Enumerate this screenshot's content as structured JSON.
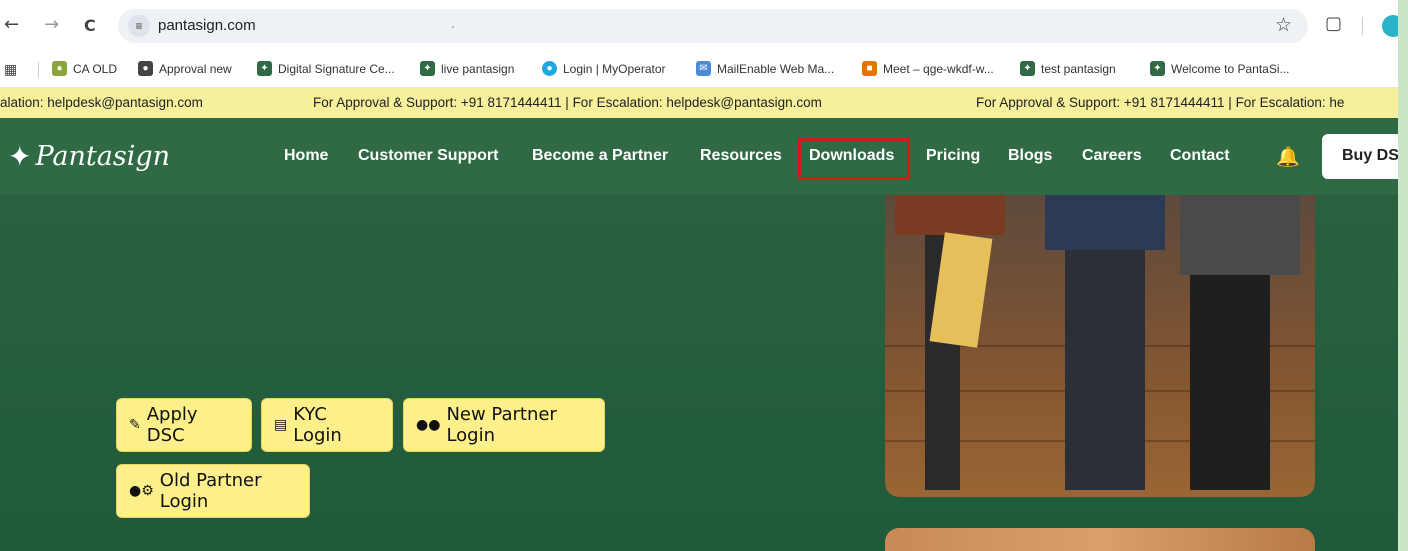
{
  "browser": {
    "url": "pantasign.com",
    "url_dot": ".",
    "nav": {
      "back": "←",
      "forward": "→",
      "reload": "C"
    },
    "site_info_icon": "tune-icon",
    "bookmark_star": "☆"
  },
  "bookmarks": [
    {
      "label": "CA OLD",
      "icon": "ca-icon",
      "color": "#8aa53a"
    },
    {
      "label": "Approval new",
      "icon": "globe-icon",
      "color": "#444444"
    },
    {
      "label": "Digital Signature Ce...",
      "icon": "pantasign-icon",
      "color": "#2f6a45"
    },
    {
      "label": "live pantasign",
      "icon": "pantasign-icon",
      "color": "#2f6a45"
    },
    {
      "label": "Login | MyOperator",
      "icon": "myoperator-icon",
      "color": "#1fa8e0"
    },
    {
      "label": "MailEnable Web Ma...",
      "icon": "mail-icon",
      "color": "#4a8cd6"
    },
    {
      "label": "Meet – qge-wkdf-w...",
      "icon": "meet-icon",
      "color": "#e37400"
    },
    {
      "label": "test pantasign",
      "icon": "pantasign-icon",
      "color": "#2f6a45"
    },
    {
      "label": "Welcome to PantaSi...",
      "icon": "pantasign-icon",
      "color": "#2f6a45"
    }
  ],
  "ticker": {
    "segments": [
      "alation: helpdesk@pantasign.com",
      "For Approval & Support: +91 8171444411   |  For Escalation: helpdesk@pantasign.com",
      "For Approval & Support: +91 8171444411   |  For Escalation: he"
    ]
  },
  "site": {
    "logo_text": "Pantasign",
    "nav": [
      "Home",
      "Customer Support",
      "Become a Partner",
      "Resources",
      "Downloads",
      "Pricing",
      "Blogs",
      "Careers",
      "Contact"
    ],
    "highlighted_nav": "Downloads",
    "buy_button": "Buy DSC"
  },
  "hero": {
    "buttons": [
      {
        "label": "Apply DSC",
        "icon": "edit-doc-icon"
      },
      {
        "label": "KYC Login",
        "icon": "id-card-icon"
      },
      {
        "label": "New Partner Login",
        "icon": "users-icon"
      },
      {
        "label": "Old Partner Login",
        "icon": "user-cog-icon"
      }
    ]
  },
  "colors": {
    "nav_bg": "#2f6a45",
    "ticker_bg": "#f6ef9c",
    "cta_bg": "#fdf08a",
    "highlight_border": "#d11a1a",
    "bell": "#f2c400"
  }
}
